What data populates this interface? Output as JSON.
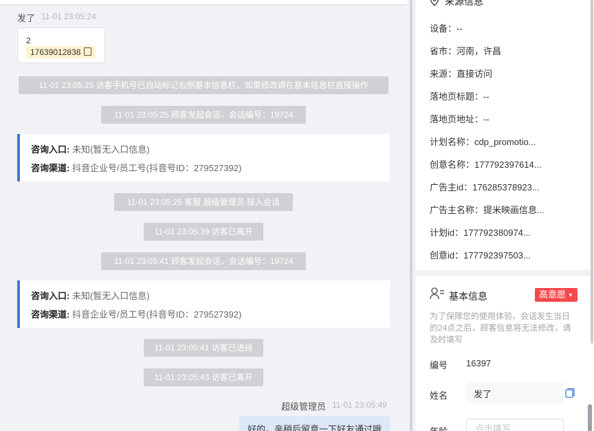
{
  "chat": {
    "visitor_msg": {
      "sender": "发了",
      "time": "11-01 23:05:24",
      "number": "2",
      "phone": "17639012838"
    },
    "system_1": "11-01 23:05:25 访客手机号已自动标记右侧基本信息栏，如需修改请在基本信息栏直接操作",
    "system_2": "11-01 23:05:25 顾客发起会话，会话编号：19724",
    "card_1": {
      "entry_label": "咨询入口:",
      "entry_value": "未知(暂无入口信息)",
      "channel_label": "咨询渠道:",
      "channel_value": "抖音企业号/员工号(抖音号ID：279527392)"
    },
    "system_3": "11-01 23:05:25 客服 超级管理员 接入会话",
    "system_4": "11-01 23:05:39 访客已离开",
    "system_5": "11-01 23:05:41 顾客发起会话，会话编号：19724",
    "card_2": {
      "entry_label": "咨询入口:",
      "entry_value": "未知(暂无入口信息)",
      "channel_label": "咨询渠道:",
      "channel_value": "抖音企业号/员工号(抖音号ID：279527392)"
    },
    "system_6": "11-01 23:05:41 访客已进线",
    "system_7": "11-01 23:05:43 访客已离开",
    "agent_msg": {
      "sender": "超级管理员",
      "time": "11-01 23:05:49",
      "text": "好的，亲稍后留意一下好友通过哦"
    }
  },
  "source_info": {
    "title": "来源信息",
    "rows": [
      "设备：--",
      "省市：河南，许昌",
      "来源：直接访问",
      "落地页标题：--",
      "落地页地址：--",
      "计划名称：cdp_promotio...",
      "创意名称：177792397614...",
      "广告主id：176285378923...",
      "广告主名称：提米映画信息...",
      "计划id：177792380974...",
      "创意id：177792397503..."
    ]
  },
  "basic_info": {
    "title": "基本信息",
    "intent_badge": "高意愿",
    "note": "为了保障您的使用体验，会话发生当日的24点之后，顾客信息将无法修改，请及时填写",
    "id_label": "编号",
    "id_value": "16397",
    "name_label": "姓名",
    "name_value": "发了",
    "age_label": "年龄",
    "age_placeholder": "点击填写"
  },
  "icons": {
    "source": "location-pin-icon",
    "basic": "person-list-icon",
    "copy": "copy-icon",
    "dropdown": "caret-down-icon"
  },
  "colors": {
    "accent": "#3a7bd5",
    "badge": "#f5484b",
    "phone_highlight": "#fff3cf"
  }
}
